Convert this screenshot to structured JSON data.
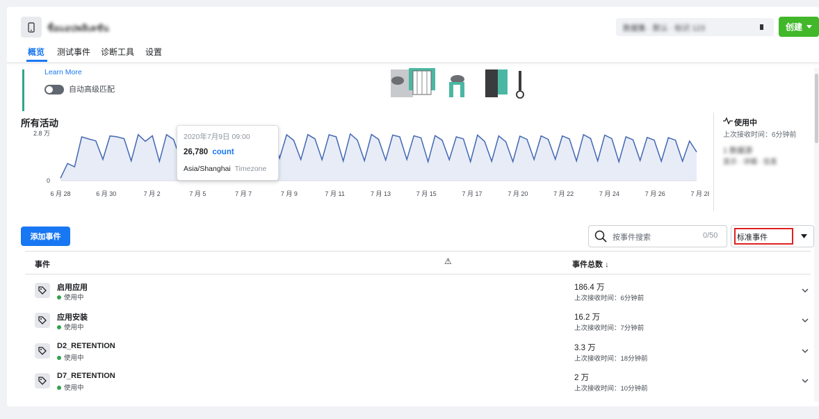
{
  "app": {
    "title": "ชื่อแอปพลิเคชัน",
    "dataset": "数据集 · 默认 · 标识 123",
    "create_label": "创建"
  },
  "tabs": [
    {
      "label": "概览",
      "active": true
    },
    {
      "label": "测试事件",
      "active": false
    },
    {
      "label": "诊断工具",
      "active": false
    },
    {
      "label": "设置",
      "active": false
    }
  ],
  "banner": {
    "link_text": "Learn More",
    "toggle_label": "自动高级匹配"
  },
  "activity": {
    "title": "所有活动",
    "status_label": "使用中",
    "last_received": "上次接收时间：6分钟前",
    "blurred_line1": "1 数据源",
    "blurred_line2": "显示 · 详细 · 信息"
  },
  "chart_data": {
    "type": "line",
    "ylim": [
      0,
      28000
    ],
    "y_ticks": [
      "0",
      "2.8 万"
    ],
    "x_ticks": [
      "6 月 28",
      "6 月 30",
      "7 月 2",
      "7 月 5",
      "7 月 7",
      "7 月 9",
      "7 月 11",
      "7 月 13",
      "7 月 15",
      "7 月 17",
      "7 月 20",
      "7 月 22",
      "7 月 24",
      "7 月 26",
      "7 月 28"
    ],
    "series": [
      {
        "values": [
          1500,
          10200,
          8200,
          26000,
          24700,
          23600,
          12600,
          26500,
          26000,
          24900,
          11700,
          27300,
          23300,
          26600,
          11400,
          27300,
          24400,
          12300,
          27900,
          26000,
          22800,
          13000,
          27400,
          24600,
          11700,
          23200,
          17300,
          27000,
          22400,
          28100,
          26780,
          13300,
          27200,
          23900,
          12500,
          27300,
          24800,
          12400,
          27200,
          26000,
          11600,
          27700,
          24100,
          11800,
          27400,
          24500,
          12200,
          27000,
          26000,
          12500,
          26600,
          25400,
          11200,
          26700,
          24000,
          12400,
          26000,
          24800,
          11300,
          27000,
          23300,
          11500,
          26500,
          23100,
          11300,
          26400,
          24500,
          12500,
          26500,
          24500,
          12700,
          26500,
          24800,
          11700,
          27300,
          25000,
          11700,
          27000,
          24900,
          11200,
          26000,
          24200,
          12000,
          25600,
          24000,
          11500,
          25500,
          24000,
          11500,
          23500,
          17000
        ]
      }
    ],
    "grid": false,
    "tooltip": {
      "datetime": "2020年7月9日 09:00",
      "value": "26,780",
      "value_label": "count",
      "timezone": "Asia/Shanghai",
      "timezone_label": "Timezone"
    }
  },
  "controls": {
    "add_event_label": "添加事件",
    "search_placeholder": "按事件搜索",
    "search_count": "0/50",
    "filter_value": "标准事件"
  },
  "table": {
    "col_event": "事件",
    "col_total": "事件总数",
    "sort_arrow": "↓",
    "warning_icon": "⚠",
    "rows": [
      {
        "name": "启用应用",
        "status": "使用中",
        "total": "186.4 万",
        "last": "上次接收时间：6分钟前"
      },
      {
        "name": "应用安装",
        "status": "使用中",
        "total": "16.2 万",
        "last": "上次接收时间：7分钟前"
      },
      {
        "name": "D2_RETENTION",
        "status": "使用中",
        "total": "3.3 万",
        "last": "上次接收时间：18分钟前"
      },
      {
        "name": "D7_RETENTION",
        "status": "使用中",
        "total": "2 万",
        "last": "上次接收时间：10分钟前"
      }
    ]
  },
  "colors": {
    "primary": "#1877f2",
    "success": "#42b72a",
    "line": "#4267b2",
    "fill": "#e7ecf7",
    "highlight": "#e02020"
  }
}
